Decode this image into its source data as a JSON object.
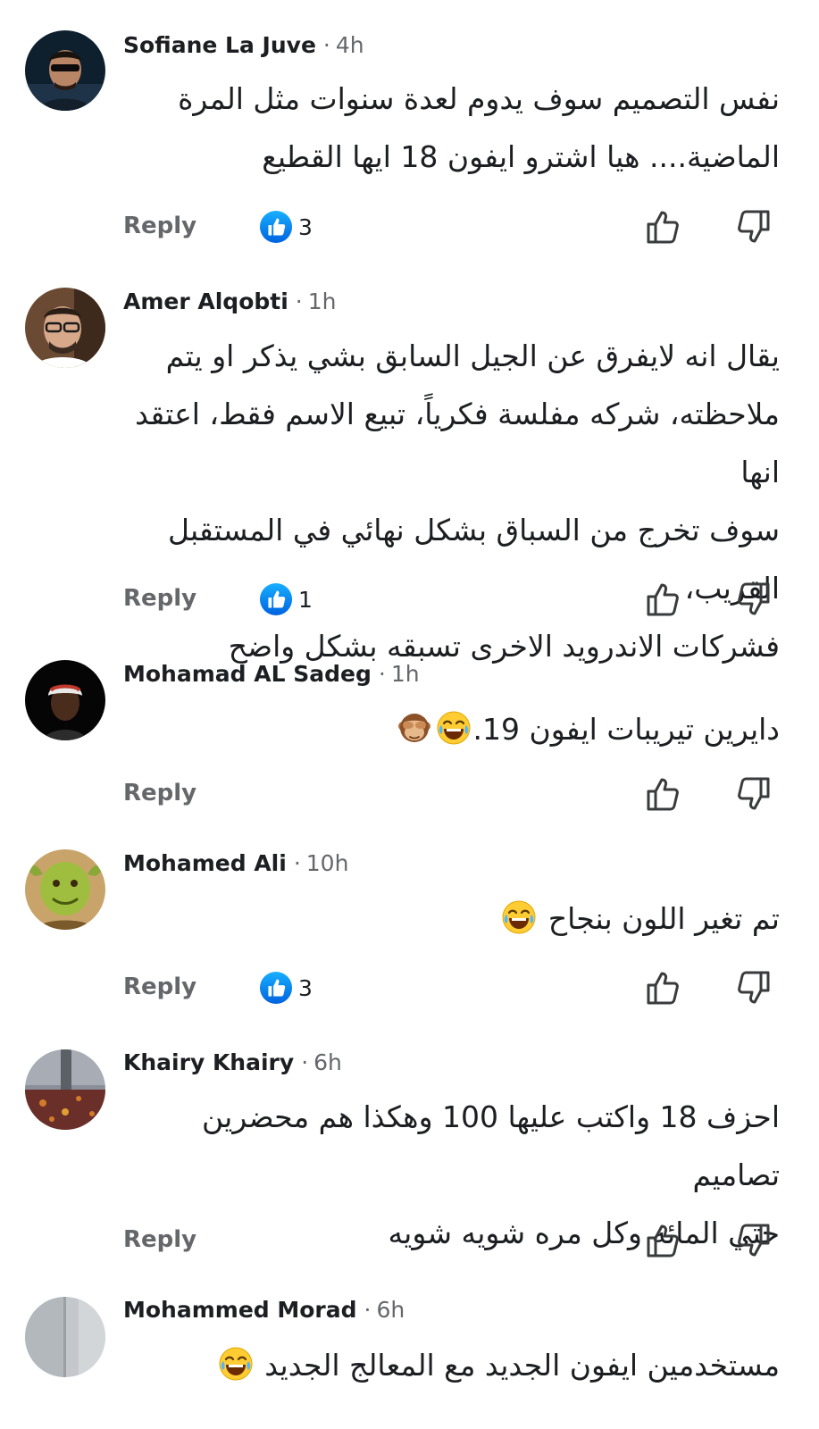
{
  "comments": [
    {
      "author": "Sofiane La Juve",
      "time": "4h",
      "line1": "نفس التصميم سوف يدوم لعدة سنوات مثل المرة",
      "line2": "الماضية.... هيا اشترو ايفون 18 ايها القطيع",
      "line3": "",
      "line4": "",
      "reply": "Reply",
      "likes": "3"
    },
    {
      "author": "Amer Alqobti",
      "time": "1h",
      "line1": "يقال انه لايفرق عن الجيل السابق بشي يذكر او يتم",
      "line2": "ملاحظته، شركه مفلسة فكرياً، تبيع الاسم فقط، اعتقد انها",
      "line3": "سوف تخرج من السباق بشكل نهائي في المستقبل القريب،",
      "line4": "فشركات الاندرويد الاخرى تسبقه بشكل واضح",
      "reply": "Reply",
      "likes": "1"
    },
    {
      "author": "Mohamad AL Sadeg",
      "time": "1h",
      "line1": "دايرين تيريبات ايفون 19.",
      "reply": "Reply",
      "emojis": [
        "face-with-tears-of-joy",
        "see-no-evil-monkey"
      ]
    },
    {
      "author": "Mohamed Ali",
      "time": "10h",
      "line1": "تم تغير اللون بنجاح",
      "reply": "Reply",
      "likes": "3",
      "emojis": [
        "face-with-tears-of-joy"
      ]
    },
    {
      "author": "Khairy Khairy",
      "time": "6h",
      "line1": "احزف 18 واكتب عليها 100 وهكذا هم محضرين تصاميم",
      "line2": "حتي المائه وكل مره شويه شويه",
      "reply": "Reply"
    },
    {
      "author": "Mohammed Morad",
      "time": "6h",
      "line1": "مستخدمين ايفون الجديد مع المعالج الجديد",
      "emojis": [
        "face-with-tears-of-joy"
      ]
    }
  ],
  "icons": {
    "like_badge": "blue-thumbs-up-reaction",
    "like_button": "thumbs-up-outline",
    "dislike_button": "thumbs-down-outline"
  },
  "colors": {
    "reaction_blue": "#1877f2",
    "secondary_text": "#65676b",
    "primary_text": "#1c1e21"
  }
}
